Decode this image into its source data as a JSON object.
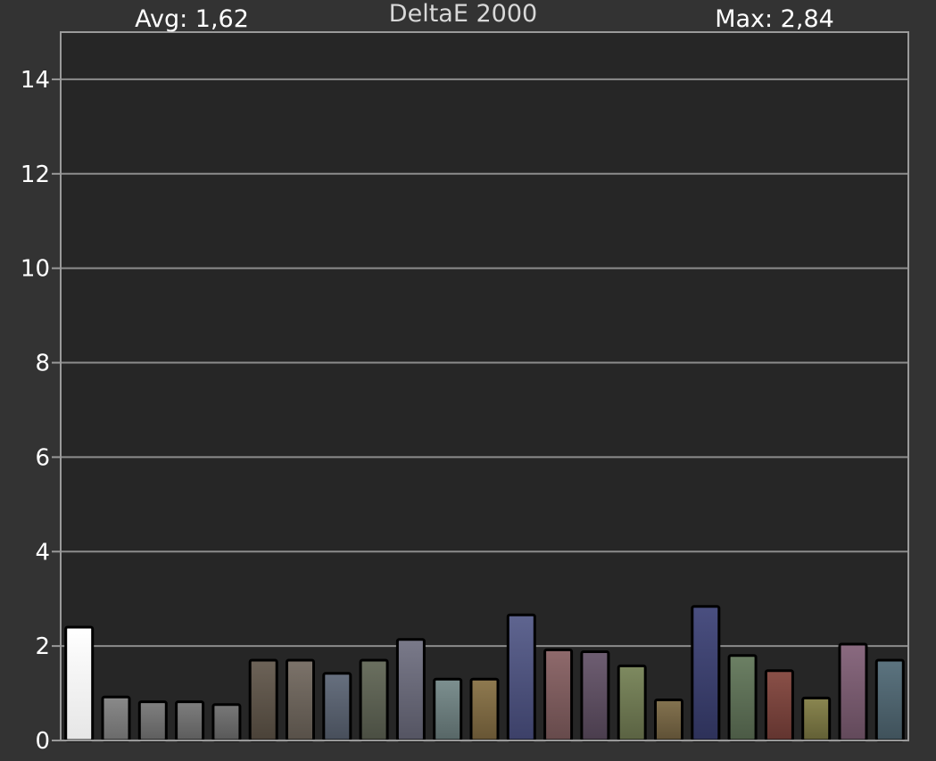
{
  "header": {
    "avg_label": "Avg: 1,62",
    "title": "DeltaE 2000",
    "max_label": "Max: 2,84"
  },
  "colors": {
    "background": "#333333",
    "plot_background": "#262626",
    "gridline": "#8c8c8c",
    "axis": "#9a9a9a"
  },
  "chart_data": {
    "type": "bar",
    "title": "DeltaE 2000",
    "xlabel": "",
    "ylabel": "",
    "ylim": [
      0,
      15
    ],
    "yticks": [
      0,
      2,
      4,
      6,
      8,
      10,
      12,
      14
    ],
    "grid": true,
    "legend": "none",
    "values": [
      2.4,
      0.92,
      0.82,
      0.82,
      0.76,
      1.7,
      1.7,
      1.42,
      1.7,
      2.14,
      1.3,
      1.3,
      2.66,
      1.92,
      1.88,
      1.58,
      0.86,
      2.84,
      1.8,
      1.48,
      0.9,
      2.04,
      1.7
    ],
    "bar_colors": [
      [
        "#ffffff",
        "#e6e6e6"
      ],
      [
        "#8a8a8a",
        "#6a6a6a"
      ],
      [
        "#808080",
        "#5e5e5e"
      ],
      [
        "#7e7e7e",
        "#5c5c5c"
      ],
      [
        "#787878",
        "#585858"
      ],
      [
        "#6d6358",
        "#4a4238"
      ],
      [
        "#7c736a",
        "#575048"
      ],
      [
        "#67707f",
        "#474e5a"
      ],
      [
        "#6b7060",
        "#4a4e42"
      ],
      [
        "#7a7a8a",
        "#545462"
      ],
      [
        "#7d9090",
        "#576666"
      ],
      [
        "#8f7a50",
        "#675534"
      ],
      [
        "#5f6590",
        "#3c4068"
      ],
      [
        "#8f6a6c",
        "#664a4b"
      ],
      [
        "#6e5e72",
        "#4a3d4d"
      ],
      [
        "#7e8a60",
        "#5a6242"
      ],
      [
        "#847350",
        "#5e5035"
      ],
      [
        "#4a4f80",
        "#2d3159"
      ],
      [
        "#6c8064",
        "#4b5a45"
      ],
      [
        "#8a5048",
        "#62342f"
      ],
      [
        "#8a8650",
        "#625f35"
      ],
      [
        "#8a6a80",
        "#62495a"
      ],
      [
        "#5c7480",
        "#3f515a"
      ]
    ]
  }
}
